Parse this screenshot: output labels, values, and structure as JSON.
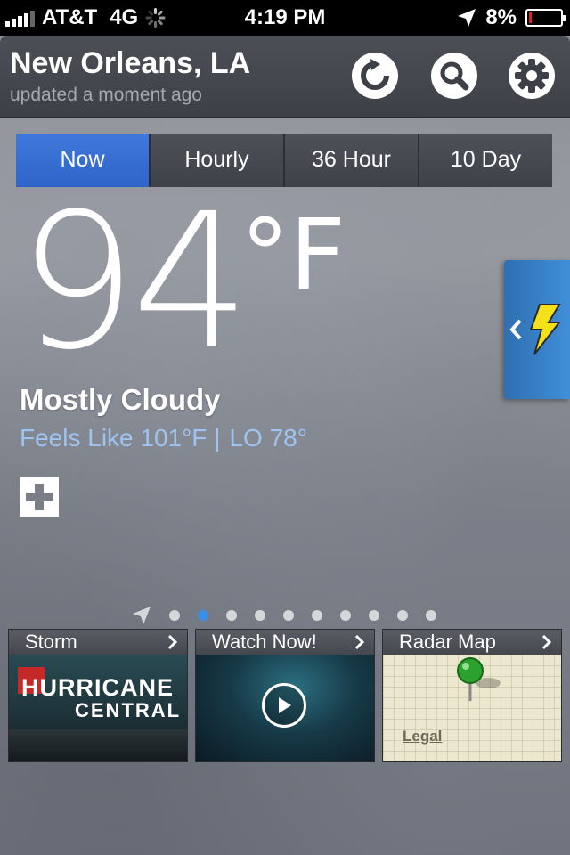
{
  "status_bar": {
    "carrier": "AT&T",
    "network": "4G",
    "time": "4:19 PM",
    "battery": "8%",
    "battery_level": 0.08
  },
  "header": {
    "city": "New Orleans, LA",
    "updated": "updated a moment ago",
    "buttons": [
      "refresh-icon",
      "search-icon",
      "gear-icon"
    ]
  },
  "tabs": [
    {
      "label": "Now",
      "active": true
    },
    {
      "label": "Hourly",
      "active": false
    },
    {
      "label": "36 Hour",
      "active": false
    },
    {
      "label": "10 Day",
      "active": false
    }
  ],
  "current": {
    "temp": "94",
    "unit": "°F",
    "condition": "Mostly Cloudy",
    "feels_like": "Feels Like 101°F |",
    "low": "LO 78°"
  },
  "page_dots": {
    "count": 10,
    "active_index": 1
  },
  "cards": [
    {
      "title": "Storm",
      "image_text_1": "HURRICANE",
      "image_text_2": "CENTRAL"
    },
    {
      "title": "Watch Now!"
    },
    {
      "title": "Radar Map",
      "legal": "Legal"
    }
  ],
  "colors": {
    "accent": "#3f78dc",
    "feels_text": "#9ec3ef",
    "alert_bolt": "#f5e11a",
    "battery_red": "#e0201b"
  }
}
